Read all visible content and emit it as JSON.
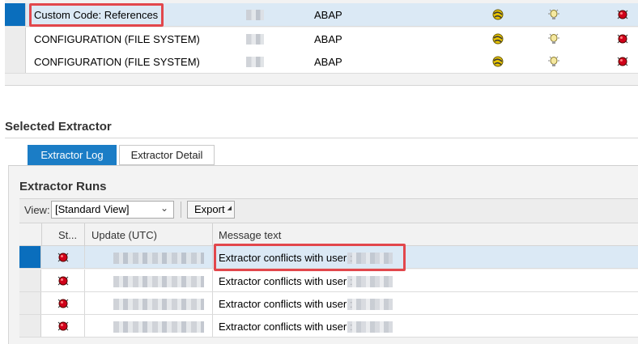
{
  "extractors": {
    "rows": [
      {
        "name": "Custom Code: References",
        "type": "ABAP",
        "selected": true
      },
      {
        "name": "CONFIGURATION (FILE SYSTEM)",
        "type": "ABAP",
        "selected": false
      },
      {
        "name": "CONFIGURATION (FILE SYSTEM)",
        "type": "ABAP",
        "selected": false
      }
    ]
  },
  "selected_extractor": {
    "title": "Selected Extractor",
    "tabs": [
      {
        "label": "Extractor Log",
        "active": true
      },
      {
        "label": "Extractor Detail",
        "active": false
      }
    ]
  },
  "extractor_runs": {
    "title": "Extractor Runs",
    "toolbar": {
      "view_label": "View:",
      "view_value": "[Standard View]",
      "export_label": "Export"
    },
    "columns": [
      "St...",
      "Update (UTC)",
      "Message text"
    ],
    "rows": [
      {
        "status": "error",
        "message": "Extractor conflicts with user :",
        "selected": true
      },
      {
        "status": "error",
        "message": "Extractor conflicts with user :",
        "selected": false
      },
      {
        "status": "error",
        "message": "Extractor conflicts with user :",
        "selected": false
      },
      {
        "status": "error",
        "message": "Extractor conflicts with user :",
        "selected": false
      }
    ]
  },
  "colors": {
    "selection_blue": "#0a6ebd",
    "selected_row": "#dbe9f5",
    "active_tab": "#1b7dc6",
    "highlight_red": "#e2474c",
    "status_red": "#d0021b"
  }
}
